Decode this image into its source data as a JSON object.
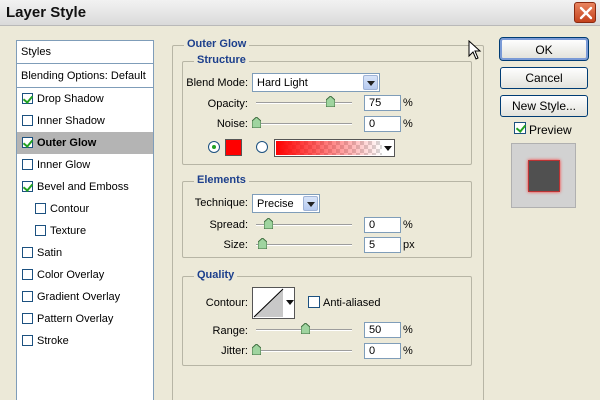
{
  "window": {
    "title": "Layer Style"
  },
  "styles": {
    "header": "Styles",
    "blending": "Blending Options: Default",
    "items": [
      {
        "label": "Drop Shadow",
        "checked": true
      },
      {
        "label": "Inner Shadow",
        "checked": false
      },
      {
        "label": "Outer Glow",
        "checked": true
      },
      {
        "label": "Inner Glow",
        "checked": false
      },
      {
        "label": "Bevel and Emboss",
        "checked": true
      },
      {
        "label": "Contour",
        "checked": false
      },
      {
        "label": "Texture",
        "checked": false
      },
      {
        "label": "Satin",
        "checked": false
      },
      {
        "label": "Color Overlay",
        "checked": false
      },
      {
        "label": "Gradient Overlay",
        "checked": false
      },
      {
        "label": "Pattern Overlay",
        "checked": false
      },
      {
        "label": "Stroke",
        "checked": false
      }
    ]
  },
  "outer_glow": {
    "title": "Outer Glow",
    "structure": {
      "title": "Structure",
      "blend_mode_label": "Blend Mode:",
      "blend_mode_value": "Hard Light",
      "opacity_label": "Opacity:",
      "opacity_value": "75",
      "noise_label": "Noise:",
      "noise_value": "0",
      "percent": "%",
      "glow_color": "#ff0000"
    },
    "elements": {
      "title": "Elements",
      "technique_label": "Technique:",
      "technique_value": "Precise",
      "spread_label": "Spread:",
      "spread_value": "0",
      "size_label": "Size:",
      "size_value": "5",
      "percent": "%",
      "px": "px"
    },
    "quality": {
      "title": "Quality",
      "contour_label": "Contour:",
      "anti_aliased_label": "Anti-aliased",
      "range_label": "Range:",
      "range_value": "50",
      "jitter_label": "Jitter:",
      "jitter_value": "0",
      "percent": "%"
    }
  },
  "buttons": {
    "ok": "OK",
    "cancel": "Cancel",
    "new_style": "New Style...",
    "preview_label": "Preview"
  },
  "colors": {
    "accent_title": "#1c3f8c",
    "glow": "#ff0000",
    "preview_swatch": "#505050"
  }
}
